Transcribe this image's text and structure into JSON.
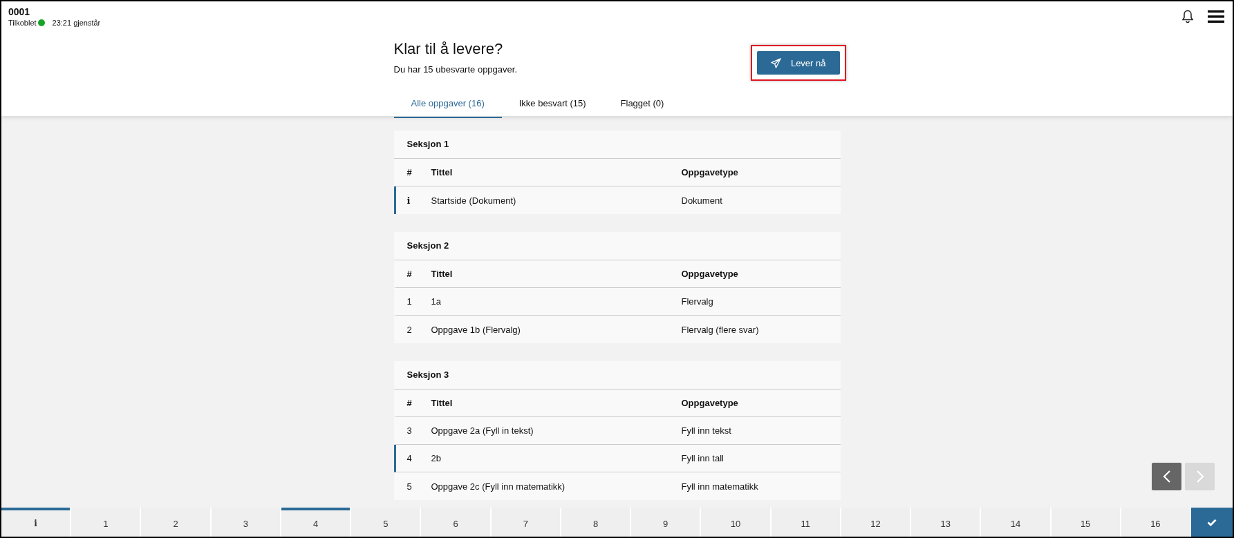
{
  "header": {
    "id": "0001",
    "status": "Tilkoblet",
    "connected": true,
    "time_left": "23:21 gjenstår"
  },
  "summary": {
    "title": "Klar til å levere?",
    "text": "Du har 15 ubesvarte oppgaver.",
    "submit_button": "Lever nå",
    "highlighted": true
  },
  "tabs": [
    {
      "label": "Alle oppgaver (16)",
      "selected": true
    },
    {
      "label": "Ikke besvart (15)",
      "selected": false
    },
    {
      "label": "Flagget (0)",
      "selected": false
    }
  ],
  "sections": [
    {
      "title": "Seksjon 1",
      "columns": [
        "#",
        "Tittel",
        "Oppgavetype"
      ],
      "rows": [
        {
          "kind": "info",
          "number": "i",
          "title": "Startside (Dokument)",
          "type": "Dokument",
          "answered": true
        }
      ]
    },
    {
      "title": "Seksjon 2",
      "columns": [
        "#",
        "Tittel",
        "Oppgavetype"
      ],
      "rows": [
        {
          "kind": "task",
          "number": "1",
          "title": "1a",
          "type": "Flervalg",
          "answered": false
        },
        {
          "kind": "task",
          "number": "2",
          "title": "Oppgave 1b (Flervalg)",
          "type": "Flervalg (flere svar)",
          "answered": false
        }
      ]
    },
    {
      "title": "Seksjon 3",
      "columns": [
        "#",
        "Tittel",
        "Oppgavetype"
      ],
      "rows": [
        {
          "kind": "task",
          "number": "3",
          "title": "Oppgave 2a (Fyll in tekst)",
          "type": "Fyll inn tekst",
          "answered": false
        },
        {
          "kind": "task",
          "number": "4",
          "title": "2b",
          "type": "Fyll inn tall",
          "answered": true
        },
        {
          "kind": "task",
          "number": "5",
          "title": "Oppgave 2c (Fyll inn matematikk)",
          "type": "Fyll inn matematikk",
          "answered": false
        }
      ]
    }
  ],
  "pager": {
    "previous": {
      "disabled": false
    },
    "next": {
      "disabled": true
    }
  },
  "task_bar": [
    {
      "kind": "info",
      "label": "i",
      "answered": true,
      "selected": false
    },
    {
      "kind": "task",
      "label": "1",
      "answered": false,
      "selected": false
    },
    {
      "kind": "task",
      "label": "2",
      "answered": false,
      "selected": false
    },
    {
      "kind": "task",
      "label": "3",
      "answered": false,
      "selected": false
    },
    {
      "kind": "task",
      "label": "4",
      "answered": true,
      "selected": false
    },
    {
      "kind": "task",
      "label": "5",
      "answered": false,
      "selected": false
    },
    {
      "kind": "task",
      "label": "6",
      "answered": false,
      "selected": false
    },
    {
      "kind": "task",
      "label": "7",
      "answered": false,
      "selected": false
    },
    {
      "kind": "task",
      "label": "8",
      "answered": false,
      "selected": false
    },
    {
      "kind": "task",
      "label": "9",
      "answered": false,
      "selected": false
    },
    {
      "kind": "task",
      "label": "10",
      "answered": false,
      "selected": false
    },
    {
      "kind": "task",
      "label": "11",
      "answered": false,
      "selected": false
    },
    {
      "kind": "task",
      "label": "12",
      "answered": false,
      "selected": false
    },
    {
      "kind": "task",
      "label": "13",
      "answered": false,
      "selected": false
    },
    {
      "kind": "task",
      "label": "14",
      "answered": false,
      "selected": false
    },
    {
      "kind": "task",
      "label": "15",
      "answered": false,
      "selected": false
    },
    {
      "kind": "task",
      "label": "16",
      "answered": false,
      "selected": false
    },
    {
      "kind": "finish",
      "selected": true
    }
  ]
}
